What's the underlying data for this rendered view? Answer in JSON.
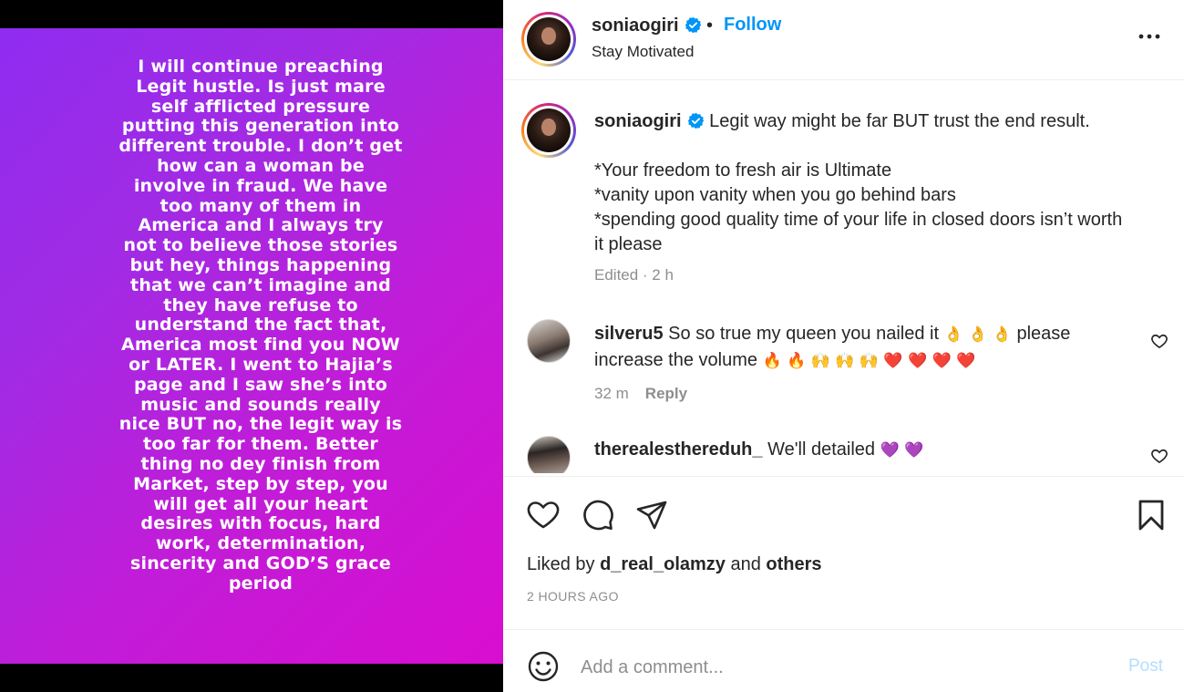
{
  "post": {
    "image_text": "I will continue preaching Legit hustle. Is just mare self afflicted pressure putting this generation into different trouble. I don’t get how can a woman be involve in fraud. We have too many of them in America and I always try not to believe those stories but hey, things happening that we can’t imagine and they have refuse to understand the fact that, America most find you NOW or LATER. I went to Hajia’s page and I saw she’s into music and sounds really nice BUT no, the legit way is too far for them. Better thing no dey finish from Market, step by step, you will get all your heart desires with focus, hard work, determination, sincerity and GOD’S grace period"
  },
  "header": {
    "username": "soniaogiri",
    "separator": "•",
    "follow_label": "Follow",
    "subtitle": "Stay Motivated"
  },
  "caption": {
    "username": "soniaogiri",
    "line1": "Legit way might be far BUT trust the end result.",
    "line2": "*Your freedom to fresh air is Ultimate",
    "line3": "*vanity upon vanity when you go behind bars",
    "line4": "*spending good quality time of your life in closed doors isn’t worth it please",
    "meta": "Edited · 2 h"
  },
  "comments": [
    {
      "username": "silveru5",
      "text_a": "So so true my queen you nailed it",
      "emoji_a": "👌 👌 👌",
      "text_b": "please increase the volume",
      "emoji_b": "🔥 🔥 🙌 🙌 🙌 ❤️ ❤️ ❤️ ❤️",
      "time": "32 m",
      "reply_label": "Reply"
    },
    {
      "username": "therealestheredu h_",
      "username_clean": "therealesthereduh_",
      "text": "We'll detailed",
      "emoji": "💜 💜"
    }
  ],
  "footer": {
    "liked_prefix": "Liked by",
    "liked_user": "d_real_olamzy",
    "liked_and": "and",
    "liked_others": "others",
    "time_ago": "2 HOURS AGO",
    "comment_placeholder": "Add a comment...",
    "post_label": "Post"
  },
  "colors": {
    "accent": "#0095f6",
    "post_disabled": "#b2dffc",
    "gradient_start": "#8f2cf0",
    "gradient_end": "#d90dd0"
  },
  "icons": [
    "verified-badge-icon",
    "more-options-icon",
    "heart-icon",
    "comment-icon",
    "share-icon",
    "save-icon",
    "emoji-icon"
  ]
}
